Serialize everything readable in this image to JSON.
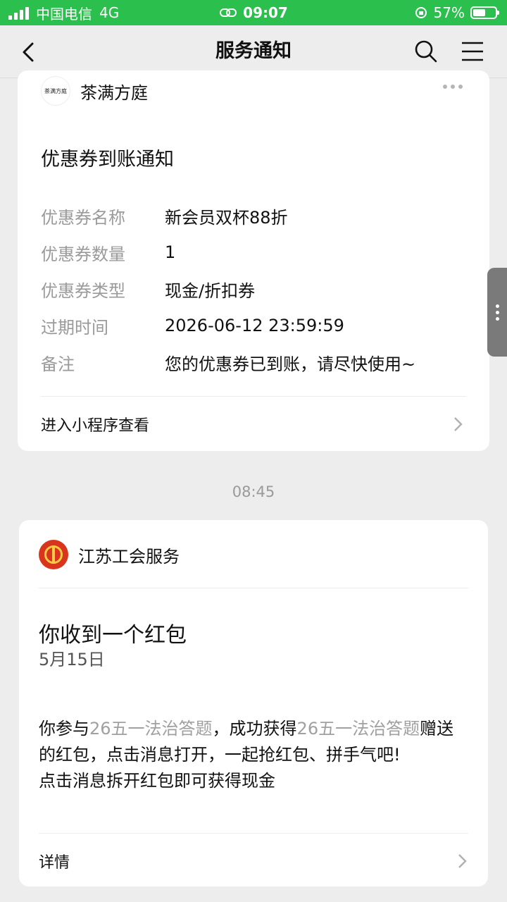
{
  "status_bar": {
    "carrier": "中国电信",
    "network": "4G",
    "time": "09:07",
    "battery": "57%",
    "battery_level": 0.57
  },
  "nav": {
    "title": "服务通知"
  },
  "card1": {
    "source_name": "茶满方庭",
    "logo_text": "茶满方庭",
    "title": "优惠券到账通知",
    "fields": [
      {
        "label": "优惠券名称",
        "value": "新会员双杯88折"
      },
      {
        "label": "优惠券数量",
        "value": "1"
      },
      {
        "label": "优惠券类型",
        "value": "现金/折扣券"
      },
      {
        "label": "过期时间",
        "value": "2026-06-12 23:59:59"
      },
      {
        "label": "备注",
        "value": "您的优惠券已到账，请尽快使用~"
      }
    ],
    "link": "进入小程序查看"
  },
  "timestamp": "08:45",
  "card2": {
    "source_name": "江苏工会服务",
    "title": "你收到一个红包",
    "date": "5月15日",
    "body": {
      "p1": "你参与",
      "hl1": "26五一法治答题",
      "p2": "，成功获得",
      "hl2": "26五一法治答题",
      "p3": "赠送的红包，点击消息打开，一起抢红包、拼手气吧!",
      "line2": "点击消息拆开红包即可获得现金"
    },
    "link": "详情"
  },
  "colors": {
    "status_green": "#2bbf4e",
    "background": "#ededed",
    "muted": "#9a9a9a"
  }
}
